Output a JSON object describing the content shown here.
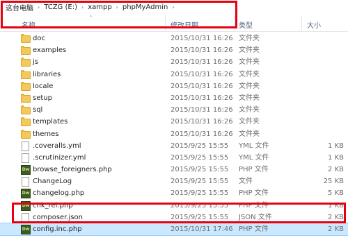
{
  "address_bar": {
    "crumbs": [
      "这台电脑",
      "TCZG (E:)",
      "xampp",
      "phpMyAdmin"
    ],
    "separator": "›"
  },
  "columns": {
    "name": "名称",
    "date": "修改日期",
    "type": "类型",
    "size": "大小"
  },
  "files": [
    {
      "name": "doc",
      "date": "2015/10/31 16:26",
      "type": "文件夹",
      "size": "",
      "icon": "folder-icon"
    },
    {
      "name": "examples",
      "date": "2015/10/31 16:26",
      "type": "文件夹",
      "size": "",
      "icon": "folder-icon"
    },
    {
      "name": "js",
      "date": "2015/10/31 16:26",
      "type": "文件夹",
      "size": "",
      "icon": "folder-icon"
    },
    {
      "name": "libraries",
      "date": "2015/10/31 16:26",
      "type": "文件夹",
      "size": "",
      "icon": "folder-icon"
    },
    {
      "name": "locale",
      "date": "2015/10/31 16:26",
      "type": "文件夹",
      "size": "",
      "icon": "folder-icon"
    },
    {
      "name": "setup",
      "date": "2015/10/31 16:26",
      "type": "文件夹",
      "size": "",
      "icon": "folder-icon"
    },
    {
      "name": "sql",
      "date": "2015/10/31 16:26",
      "type": "文件夹",
      "size": "",
      "icon": "folder-icon"
    },
    {
      "name": "templates",
      "date": "2015/10/31 16:26",
      "type": "文件夹",
      "size": "",
      "icon": "folder-icon"
    },
    {
      "name": "themes",
      "date": "2015/10/31 16:26",
      "type": "文件夹",
      "size": "",
      "icon": "folder-icon"
    },
    {
      "name": ".coveralls.yml",
      "date": "2015/9/25 15:55",
      "type": "YML 文件",
      "size": "1 KB",
      "icon": "file-icon"
    },
    {
      "name": ".scrutinizer.yml",
      "date": "2015/9/25 15:55",
      "type": "YML 文件",
      "size": "1 KB",
      "icon": "file-icon"
    },
    {
      "name": "browse_foreigners.php",
      "date": "2015/9/25 15:55",
      "type": "PHP 文件",
      "size": "2 KB",
      "icon": "dreamweaver-php-icon"
    },
    {
      "name": "ChangeLog",
      "date": "2015/9/25 15:55",
      "type": "文件",
      "size": "25 KB",
      "icon": "file-icon"
    },
    {
      "name": "changelog.php",
      "date": "2015/9/25 15:55",
      "type": "PHP 文件",
      "size": "5 KB",
      "icon": "dreamweaver-php-icon"
    },
    {
      "name": "chk_rel.php",
      "date": "2015/9/25 15:55",
      "type": "PHP 文件",
      "size": "1 KB",
      "icon": "dreamweaver-php-icon"
    },
    {
      "name": "composer.json",
      "date": "2015/9/25 15:55",
      "type": "JSON 文件",
      "size": "2 KB",
      "icon": "file-icon"
    },
    {
      "name": "config.inc.php",
      "date": "2015/10/31 17:46",
      "type": "PHP 文件",
      "size": "2 KB",
      "icon": "dreamweaver-php-icon",
      "selected": true
    }
  ],
  "colors": {
    "highlight": "#e60012",
    "selection": "#cce8ff"
  }
}
